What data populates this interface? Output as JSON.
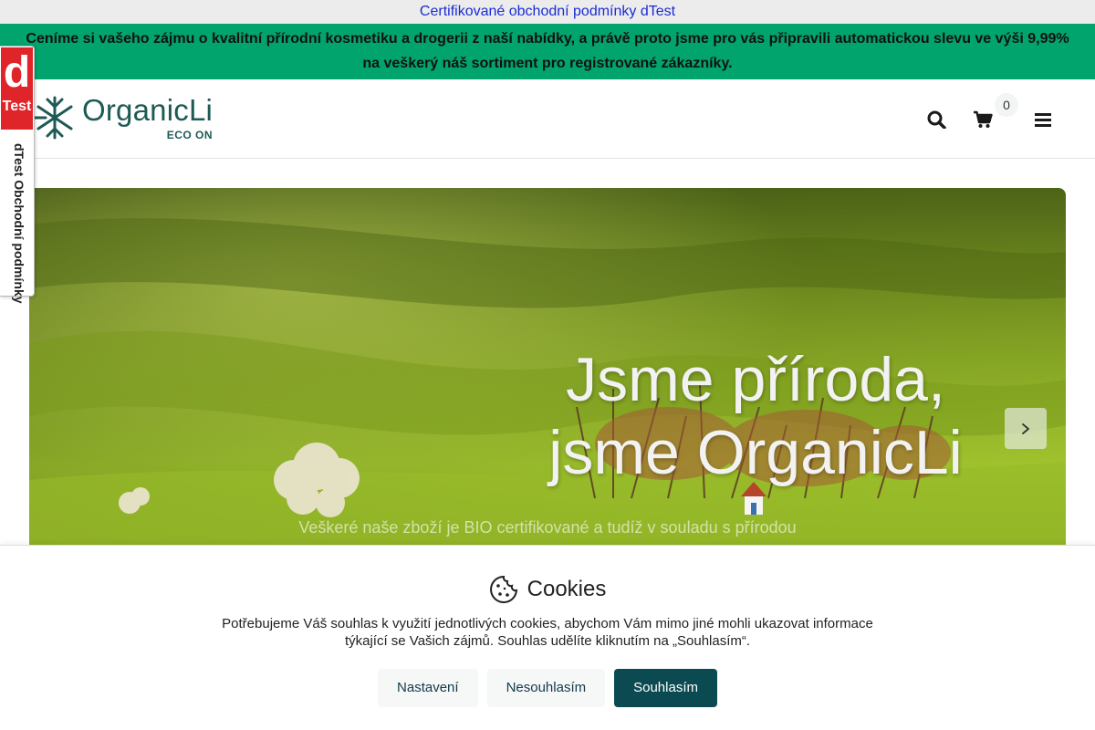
{
  "topbar": {
    "link_text": "Certifikované obchodní podmínky dTest"
  },
  "promo": {
    "line1": "Ceníme si vašeho zájmu o kvalitní přírodní kosmetiku a drogerii z naší nabídky, a právě proto jsme pro vás připravili automatickou slevu ve výši 9,99%",
    "line2": "na veškerý náš sortiment pro registrované zákazníky."
  },
  "header": {
    "logo_name": "OrganicLi",
    "logo_sub": "ECO ON",
    "cart_count": "0",
    "icons": [
      "search-icon",
      "cart-icon",
      "menu-icon"
    ]
  },
  "dtest_badge": {
    "logo_d": "d",
    "logo_test": "Test",
    "vertical_text": "dTest Obchodní podmínky"
  },
  "hero": {
    "title_line1": "Jsme příroda,",
    "title_line2": "jsme OrganicLi",
    "subtitle": "Veškeré naše zboží je BIO certifikované a tudíž v souladu s přírodou",
    "next_icon": "chevron-right-icon"
  },
  "cookies": {
    "title": "Cookies",
    "text_line1": "Potřebujeme Váš souhlas k využití jednotlivých cookies, abychom Vám mimo jiné mohli ukazovat informace",
    "text_line2": "týkající se Vašich zájmů. Souhlas udělíte kliknutím na „Souhlasím“.",
    "buttons": {
      "settings": "Nastavení",
      "decline": "Nesouhlasím",
      "accept": "Souhlasím"
    }
  },
  "colors": {
    "promo_bg": "#00a46c",
    "brand": "#1e5a55",
    "accept_btn": "#0c4a52",
    "dtest_red": "#e0252a"
  }
}
